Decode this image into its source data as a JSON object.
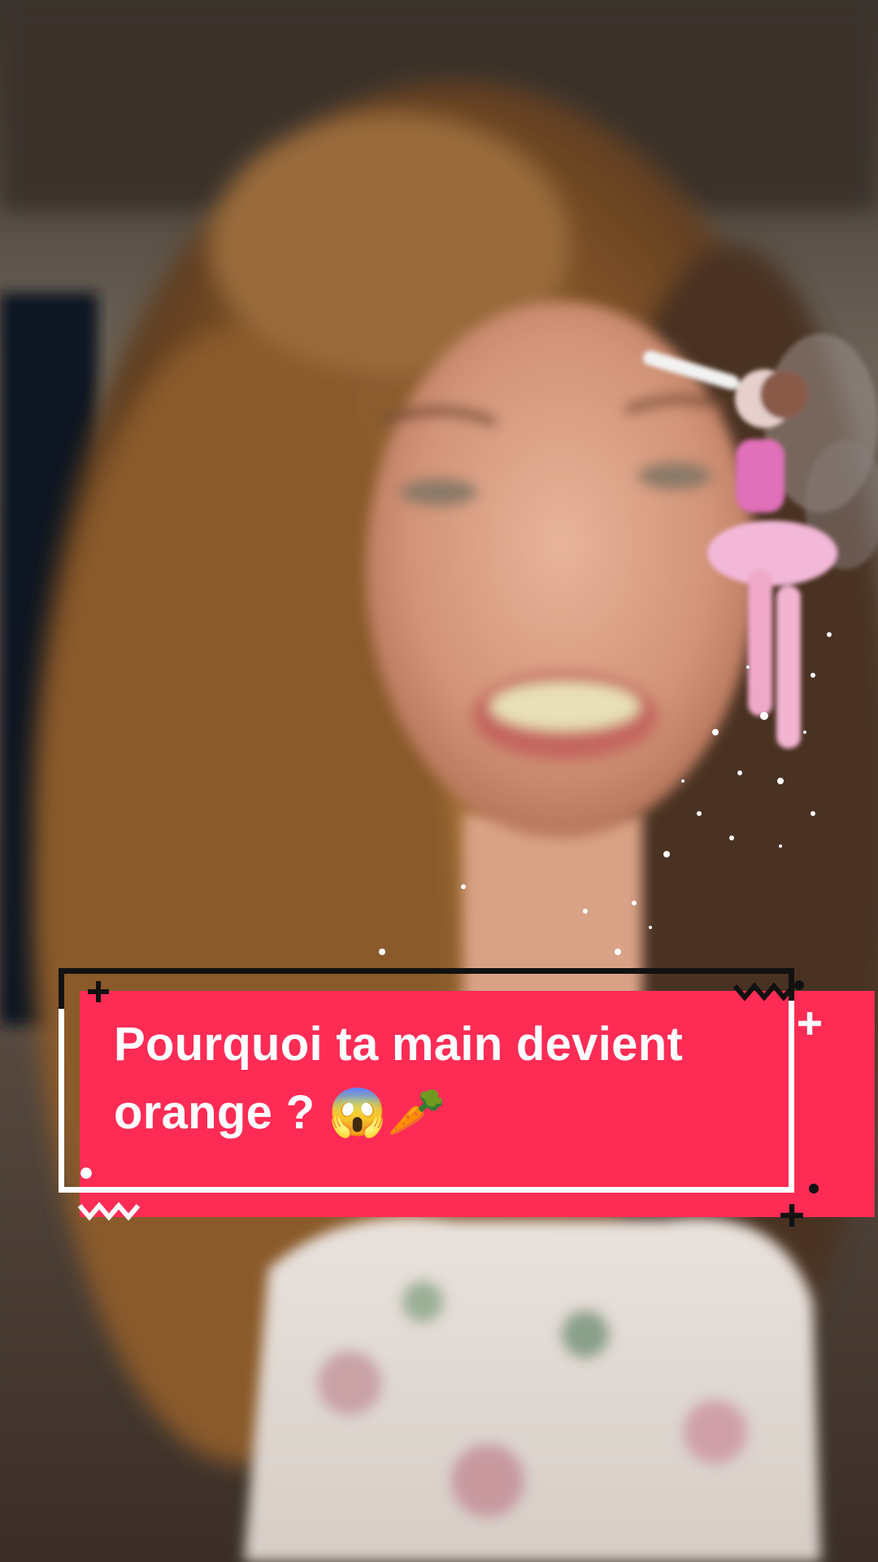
{
  "caption": {
    "text": "Pourquoi ta main devient orange ? 😱🥕",
    "background_color": "#fe2c55",
    "text_color": "#ffffff"
  },
  "scene": {
    "subject": "person-with-curly-hair",
    "overlay": "fairy-sticker"
  }
}
